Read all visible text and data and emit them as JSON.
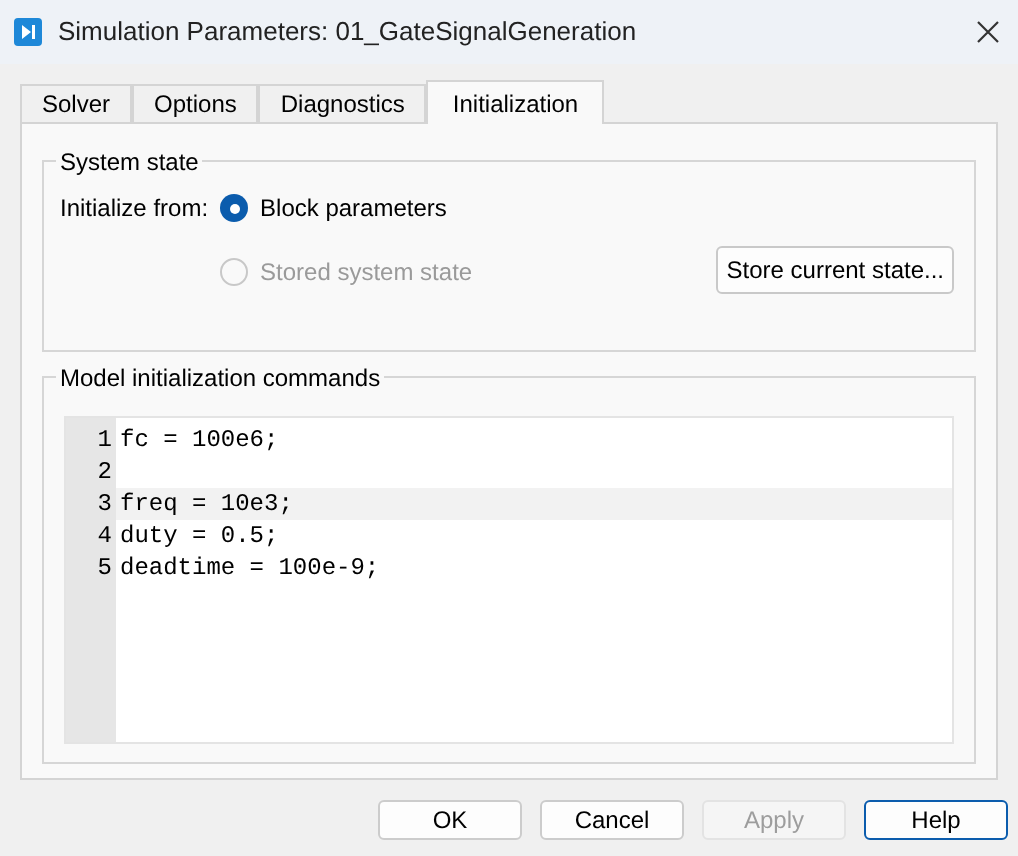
{
  "window": {
    "title": "Simulation Parameters: 01_GateSignalGeneration"
  },
  "tabs": [
    {
      "label": "Solver",
      "selected": false
    },
    {
      "label": "Options",
      "selected": false
    },
    {
      "label": "Diagnostics",
      "selected": false
    },
    {
      "label": "Initialization",
      "selected": true
    }
  ],
  "system_state": {
    "title": "System state",
    "label": "Initialize from:",
    "options": [
      {
        "label": "Block parameters",
        "selected": true,
        "disabled": false
      },
      {
        "label": "Stored system state",
        "selected": false,
        "disabled": true
      }
    ],
    "store_button": "Store current state..."
  },
  "commands": {
    "title": "Model initialization commands",
    "lines": [
      {
        "number": "1",
        "code": "fc = 100e6;",
        "selected": false
      },
      {
        "number": "2",
        "selected": false
      },
      {
        "number": "3",
        "code": "freq = 10e3;",
        "selected": true
      },
      {
        "number": "4",
        "code": "duty = 0.5;",
        "selected": false
      },
      {
        "number": "5",
        "code": "deadtime = 100e-9;",
        "selected": false
      }
    ]
  },
  "buttons": [
    {
      "label": "OK",
      "disabled": false,
      "focused": false
    },
    {
      "label": "Cancel",
      "disabled": false,
      "focused": false
    },
    {
      "label": "Apply",
      "disabled": true,
      "focused": false
    },
    {
      "label": "Help",
      "disabled": false,
      "focused": true
    }
  ]
}
